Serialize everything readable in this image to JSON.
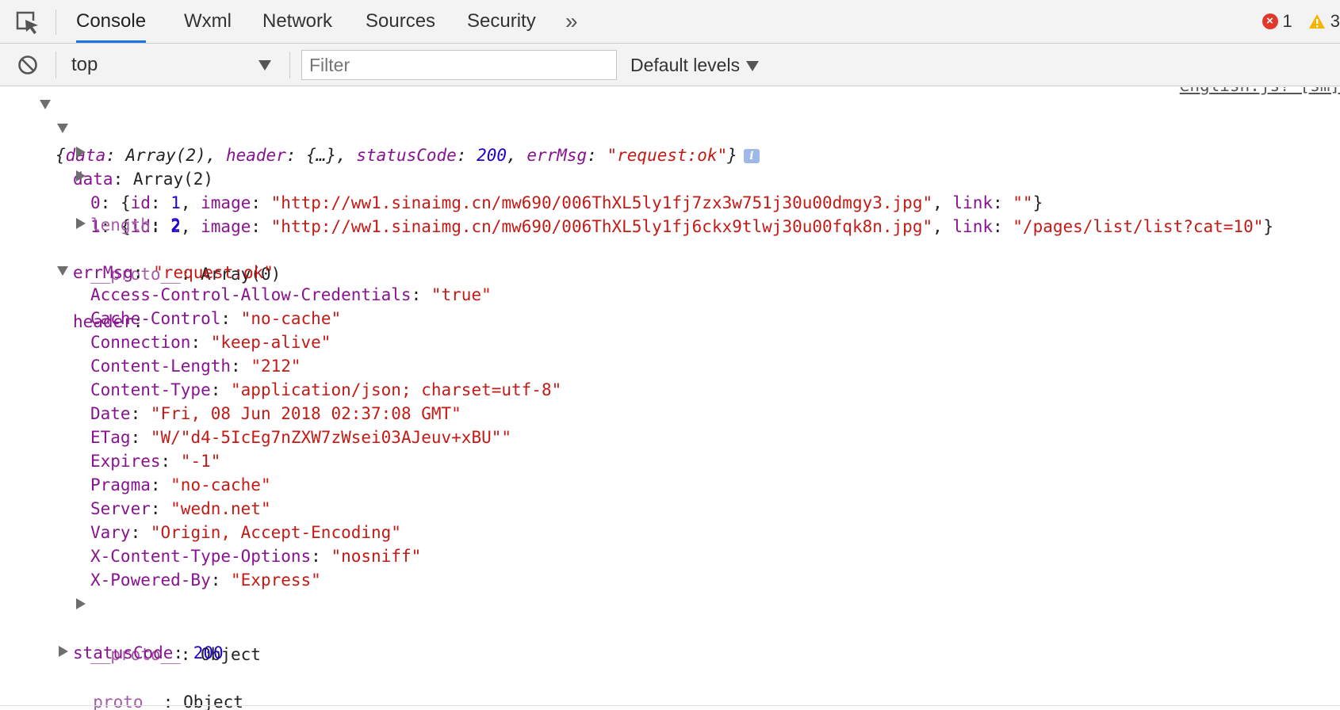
{
  "tabs": [
    {
      "label": "Console",
      "active": true
    },
    {
      "label": "Wxml",
      "active": false
    },
    {
      "label": "Network",
      "active": false
    },
    {
      "label": "Sources",
      "active": false
    },
    {
      "label": "Security",
      "active": false
    }
  ],
  "tab_overflow_icon": "double-chevron-right-icon",
  "counts": {
    "errors": "1",
    "warnings": "3"
  },
  "toolbar": {
    "context": "top",
    "filter_placeholder": "Filter",
    "levels": "Default levels"
  },
  "colors": {
    "accent": "#1a73e8",
    "key": "#881391",
    "string": "#c41a16",
    "number": "#1c00cf"
  },
  "console": {
    "source_link": "english.js? [sm]",
    "summary": {
      "open": "{",
      "k1": "data",
      "v1": "Array(2)",
      "k2": "header",
      "v2": "{…}",
      "k3": "statusCode",
      "v3": "200",
      "k4": "errMsg",
      "v4": "\"request:ok\"",
      "close": "}",
      "info": "i"
    },
    "data": {
      "key": "data",
      "value": "Array(2)",
      "items": [
        {
          "index": "0",
          "id": "1",
          "image": "\"http://ww1.sinaimg.cn/mw690/006ThXL5ly1fj7zx3w751j30u00dmgy3.jpg\"",
          "link": "\"\""
        },
        {
          "index": "1",
          "id": "2",
          "image": "\"http://ww1.sinaimg.cn/mw690/006ThXL5ly1fj6ckx9tlwj30u00fqk8n.jpg\"",
          "link": "\"/pages/list/list?cat=10\""
        }
      ],
      "length_key": "length",
      "length_value": "2",
      "proto_key": "__proto__",
      "proto_value": "Array(0)"
    },
    "errMsg": {
      "key": "errMsg",
      "value": "\"request:ok\""
    },
    "header": {
      "key": "header",
      "entries": [
        {
          "key": "Access-Control-Allow-Credentials",
          "value": "\"true\""
        },
        {
          "key": "Cache-Control",
          "value": "\"no-cache\""
        },
        {
          "key": "Connection",
          "value": "\"keep-alive\""
        },
        {
          "key": "Content-Length",
          "value": "\"212\""
        },
        {
          "key": "Content-Type",
          "value": "\"application/json; charset=utf-8\""
        },
        {
          "key": "Date",
          "value": "\"Fri, 08 Jun 2018 02:37:08 GMT\""
        },
        {
          "key": "ETag",
          "value": "\"W/\"d4-5IcEg7nZXW7zWsei03AJeuv+xBU\"\""
        },
        {
          "key": "Expires",
          "value": "\"-1\""
        },
        {
          "key": "Pragma",
          "value": "\"no-cache\""
        },
        {
          "key": "Server",
          "value": "\"wedn.net\""
        },
        {
          "key": "Vary",
          "value": "\"Origin, Accept-Encoding\""
        },
        {
          "key": "X-Content-Type-Options",
          "value": "\"nosniff\""
        },
        {
          "key": "X-Powered-By",
          "value": "\"Express\""
        }
      ],
      "proto_key": "__proto__",
      "proto_value": "Object"
    },
    "statusCode": {
      "key": "statusCode",
      "value": "200"
    },
    "root_proto": {
      "key": "__proto__",
      "value": "Object"
    }
  }
}
